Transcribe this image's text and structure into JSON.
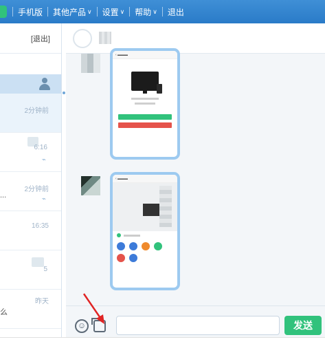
{
  "menu": {
    "items": [
      {
        "label": "手机版"
      },
      {
        "label": "其他产品",
        "caret": "∨"
      },
      {
        "label": "设置",
        "caret": "∨"
      },
      {
        "label": "帮助",
        "caret": "∨"
      },
      {
        "label": "退出"
      }
    ]
  },
  "sidebar": {
    "logout_label": "[退出]",
    "conversations": [
      {
        "time": "2分钟前",
        "sub": ""
      },
      {
        "time": "6:16",
        "sub": ""
      },
      {
        "time": "2分钟前",
        "sub": "..."
      },
      {
        "time": "16:35",
        "sub": ""
      },
      {
        "time": "5",
        "sub": ""
      },
      {
        "time": "昨天",
        "sub": "么"
      }
    ]
  },
  "chat": {
    "input_value": "",
    "send_label": "发送"
  },
  "icons": {
    "user": "user-icon",
    "emoji": "emoji-icon",
    "screenshot": "screenshot-icon",
    "arrow": "red-arrow-annotation"
  },
  "colors": {
    "topbar": "#2a7bc8",
    "accent_green": "#31c27c",
    "bubble_border": "#9dcaf0",
    "arrow_red": "#e02424"
  }
}
